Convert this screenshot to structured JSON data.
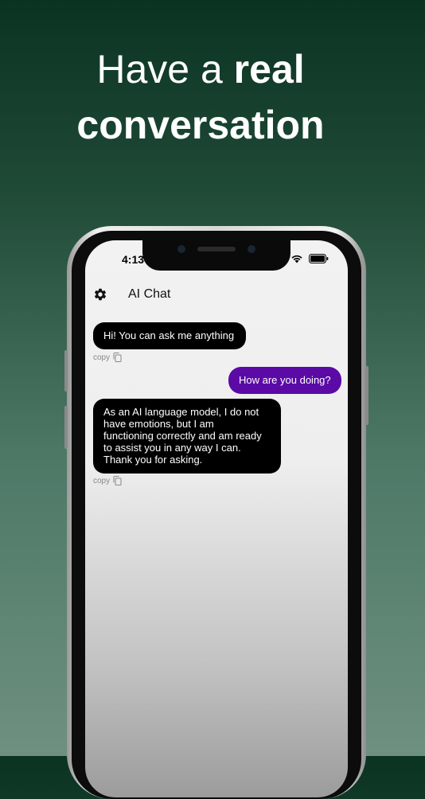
{
  "headline": {
    "line1_regular": "Have a ",
    "line1_bold": "real",
    "line2": "conversation"
  },
  "status_bar": {
    "time": "4:13",
    "icons": [
      "wifi-icon",
      "battery-icon"
    ]
  },
  "app_bar": {
    "settings_icon": "gear-icon",
    "title": "AI Chat"
  },
  "messages": [
    {
      "role": "assistant",
      "text": "Hi! You can ask me anything",
      "copy_label": "copy"
    },
    {
      "role": "user",
      "text": "How are you doing?"
    },
    {
      "role": "assistant",
      "lines": [
        "As an AI language model, I do not",
        "have emotions, but I am",
        "functioning correctly and am ready",
        "to assist you in any way I can.",
        "Thank you for asking."
      ],
      "copy_label": "copy"
    }
  ],
  "colors": {
    "user_bubble": "#5b0aa6",
    "assistant_bubble": "#000000"
  }
}
